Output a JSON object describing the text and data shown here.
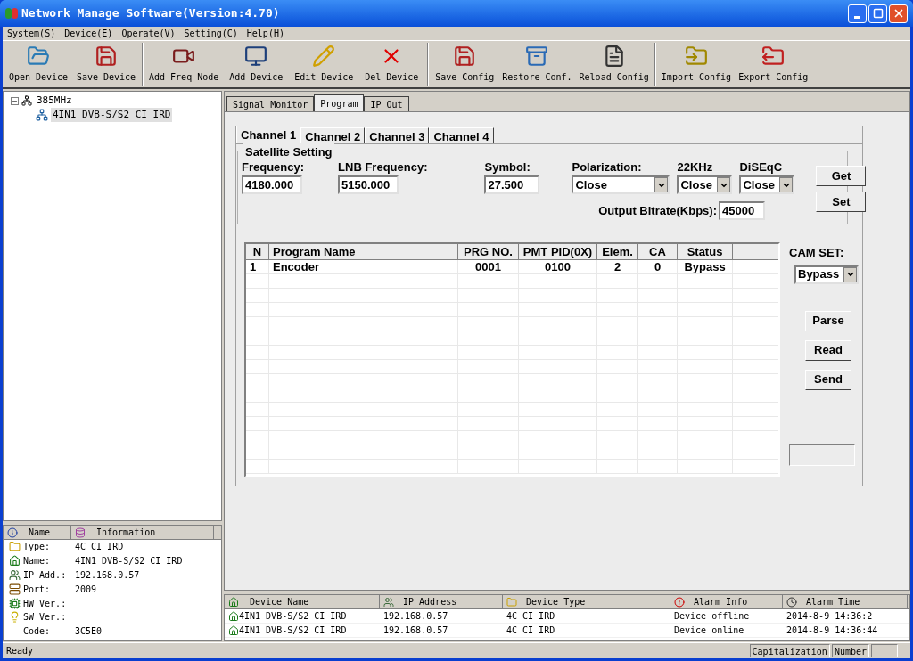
{
  "window": {
    "title": "Network Manage Software(Version:4.70)"
  },
  "menu": [
    "System(S)",
    "Device(E)",
    "Operate(V)",
    "Setting(C)",
    "Help(H)"
  ],
  "toolbar": [
    {
      "label": "Open Device",
      "kind": "open"
    },
    {
      "label": "Save Device",
      "kind": "save"
    },
    {
      "label": "Add Freq Node",
      "kind": "freq",
      "group_start": true
    },
    {
      "label": "Add Device",
      "kind": "add"
    },
    {
      "label": "Edit Device",
      "kind": "edit"
    },
    {
      "label": "Del Device",
      "kind": "del"
    },
    {
      "label": "Save Config",
      "kind": "save",
      "group_start": true
    },
    {
      "label": "Restore Conf.",
      "kind": "restore"
    },
    {
      "label": "Reload Config",
      "kind": "reload"
    },
    {
      "label": "Import Config",
      "kind": "import",
      "group_start": true
    },
    {
      "label": "Export Config",
      "kind": "export"
    }
  ],
  "tree": [
    {
      "label": "385MHz",
      "expanded": true,
      "children": [
        {
          "label": "4IN1 DVB-S/S2 CI IRD",
          "selected": true
        }
      ]
    }
  ],
  "info": {
    "columns": [
      "Name",
      "Information"
    ],
    "rows": [
      {
        "name": "Type:",
        "value": "4C CI IRD",
        "kind": "type"
      },
      {
        "name": "Name:",
        "value": "4IN1 DVB-S/S2 CI IRD",
        "kind": "name"
      },
      {
        "name": "IP Add.:",
        "value": "192.168.0.57",
        "kind": "ip"
      },
      {
        "name": "Port:",
        "value": "2009",
        "kind": "port"
      },
      {
        "name": "HW Ver.:",
        "kind": "hw"
      },
      {
        "name": "SW Ver.:",
        "kind": "sw"
      },
      {
        "name": "Code:",
        "value": "3C5E0",
        "kind": "none"
      }
    ]
  },
  "tabs": [
    {
      "label": "Signal Monitor",
      "selected": false
    },
    {
      "label": "Program",
      "selected": true
    },
    {
      "label": "IP Out",
      "selected": false
    }
  ],
  "channel_tabs": [
    {
      "label": "Channel 1",
      "selected": true
    },
    {
      "label": "Channel 2",
      "selected": false
    },
    {
      "label": "Channel 3",
      "selected": false
    },
    {
      "label": "Channel 4",
      "selected": false
    }
  ],
  "satellite": {
    "title": "Satellite Setting",
    "fields": [
      {
        "label": "Frequency:",
        "value": "4180.000",
        "kind": "text"
      },
      {
        "label": "LNB Frequency:",
        "value": "5150.000",
        "kind": "text"
      },
      {
        "label": "Symbol:",
        "value": "27.500",
        "kind": "text"
      },
      {
        "label": "Polarization:",
        "value": "Close",
        "kind": "select"
      },
      {
        "label": "22KHz",
        "value": "Close",
        "kind": "select"
      },
      {
        "label": "DiSEqC",
        "value": "Close",
        "kind": "select"
      }
    ],
    "bitrate": {
      "label": "Output Bitrate(Kbps):",
      "value": "45000"
    },
    "buttons": [
      "Get",
      "Set"
    ]
  },
  "programs": {
    "columns": [
      "N",
      "Program Name",
      "PRG NO.",
      "PMT PID(0X)",
      "Elem.",
      "CA",
      "Status"
    ],
    "rows": [
      [
        "1",
        "Encoder",
        "0001",
        "0100",
        "2",
        "0",
        "Bypass"
      ]
    ]
  },
  "cam_set": {
    "label": "CAM SET:",
    "value": "Bypass"
  },
  "program_buttons": [
    "Parse",
    "Read",
    "Send"
  ],
  "alarms": {
    "columns": [
      "Device Name",
      "IP Address",
      "Device Type",
      "Alarm Info",
      "Alarm Time"
    ],
    "rows": [
      [
        "4IN1 DVB-S/S2 CI IRD",
        "192.168.0.57",
        "4C CI IRD",
        "Device offline",
        "2014-8-9 14:36:2"
      ],
      [
        "4IN1 DVB-S/S2 CI IRD",
        "192.168.0.57",
        "4C CI IRD",
        "Device online",
        "2014-8-9 14:36:44"
      ]
    ]
  },
  "status_bar": {
    "text": "Ready",
    "panels": [
      "Capitalization",
      "Number"
    ]
  }
}
